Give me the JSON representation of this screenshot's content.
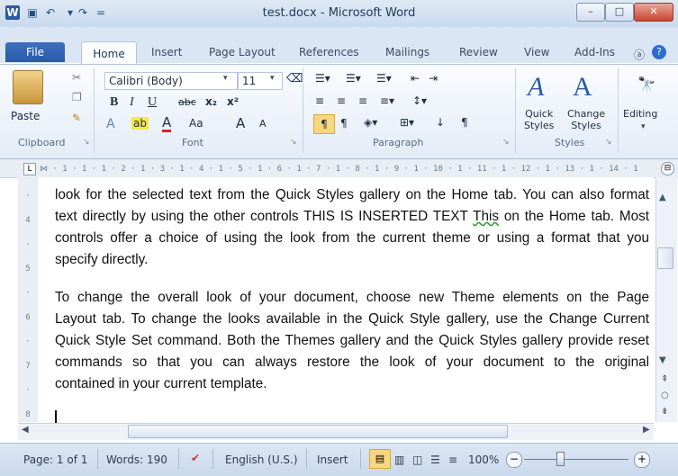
{
  "window": {
    "title": "test.docx - Microsoft Word",
    "minimize": "–",
    "maximize": "□",
    "close": "✕"
  },
  "tabs": {
    "file": "File",
    "items": [
      "Home",
      "Insert",
      "Page Layout",
      "References",
      "Mailings",
      "Review",
      "View",
      "Add-Ins"
    ]
  },
  "ribbon": {
    "clipboard": {
      "paste": "Paste",
      "label": "Clipboard"
    },
    "font": {
      "name": "Calibri (Body)",
      "size": "11",
      "label": "Font",
      "bold": "B",
      "italic": "I",
      "underline": "U",
      "strike": "abc",
      "sub": "x₂",
      "sup": "x²",
      "grow": "A",
      "shrink": "A",
      "case": "Aa"
    },
    "paragraph": {
      "label": "Paragraph"
    },
    "styles": {
      "quick": "Quick\nStyles",
      "change": "Change\nStyles",
      "label": "Styles"
    },
    "editing": {
      "label": "Editing"
    }
  },
  "document": {
    "lines": [
      [
        "look for the selected text from the Quick Styles gallery on the Home tab. You can also format"
      ],
      [
        "text directly by using the other controls THIS IS INSERTED TEXT ",
        "This",
        " on the Home tab. Most"
      ],
      [
        "controls offer a choice of using the look from the current theme or using a format that you"
      ],
      [
        "specify directly."
      ],
      [
        "To change the overall look of your document, choose new Theme elements on the Page"
      ],
      [
        "Layout tab. To change the looks available in the Quick Style gallery, use the Change Current"
      ],
      [
        "Quick Style Set command. Both the Themes gallery and the Quick Styles gallery provide reset"
      ],
      [
        "commands so that you can always restore the look of your document to the original"
      ],
      [
        "contained in your current template."
      ]
    ]
  },
  "status": {
    "page": "Page: 1 of 1",
    "words": "Words: 190",
    "language": "English (U.S.)",
    "mode": "Insert",
    "zoom": "100%"
  },
  "colors": {
    "accent": "#2a5aa8",
    "spelling_underline": "#2e9b2e"
  }
}
